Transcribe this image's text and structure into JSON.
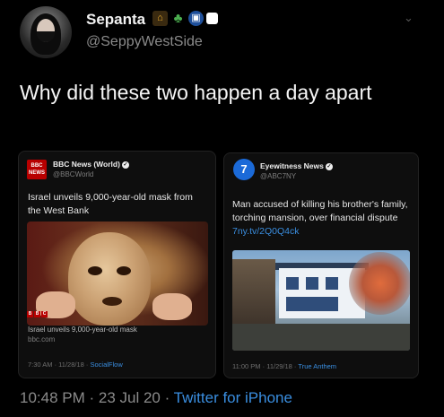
{
  "header": {
    "name": "Sepanta",
    "handle": "@SeppyWestSide",
    "emojis": [
      "house-emoji",
      "palm-tree-emoji",
      "bus-emoji",
      "white-square-emoji"
    ]
  },
  "tweet": {
    "text": "Why did these two happen a day apart"
  },
  "cards": [
    {
      "account_name": "BBC News (World)",
      "account_handle": "@BBCWorld",
      "logo_text": "BBC NEWS",
      "text": "Israel unveils 9,000-year-old mask from the West Bank",
      "caption": "Israel unveils 9,000-year-old mask",
      "caption_domain": "bbc.com",
      "timestamp": "7:30 AM · 11/28/18 · ",
      "app": "SocialFlow"
    },
    {
      "account_name": "Eyewitness News",
      "account_handle": "@ABC7NY",
      "logo_text": "7",
      "text_before_link": "Man accused of killing his brother's family, torching mansion, over financial dispute ",
      "link": "7ny.tv/2Q0Q4ck",
      "timestamp": "11:00 PM · 11/29/18 · ",
      "app": "True Anthem"
    }
  ],
  "footer": {
    "time": "10:48 PM · 23 Jul 20 · ",
    "app": "Twitter for iPhone"
  },
  "colors": {
    "background": "#000000",
    "link": "#3a8ee0",
    "bbc_red": "#b80000",
    "abc_blue": "#1b6ad8"
  }
}
